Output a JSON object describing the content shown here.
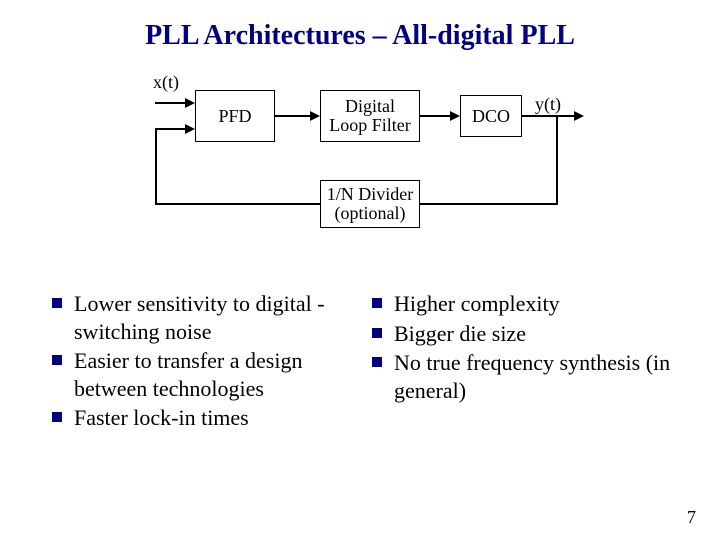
{
  "title": "PLL Architectures – All-digital PLL",
  "diagram": {
    "input_label": "x(t)",
    "output_label": "y(t)",
    "blocks": {
      "pfd": "PFD",
      "filter": "Digital\nLoop Filter",
      "dco": "DCO",
      "divider": "1/N Divider\n(optional)"
    }
  },
  "pros": [
    "Lower sensitivity to digital -switching noise",
    "Easier to transfer a design between technologies",
    "Faster lock-in times"
  ],
  "cons": [
    "Higher complexity",
    "Bigger die size",
    "No true frequency synthesis (in general)"
  ],
  "page_number": "7"
}
